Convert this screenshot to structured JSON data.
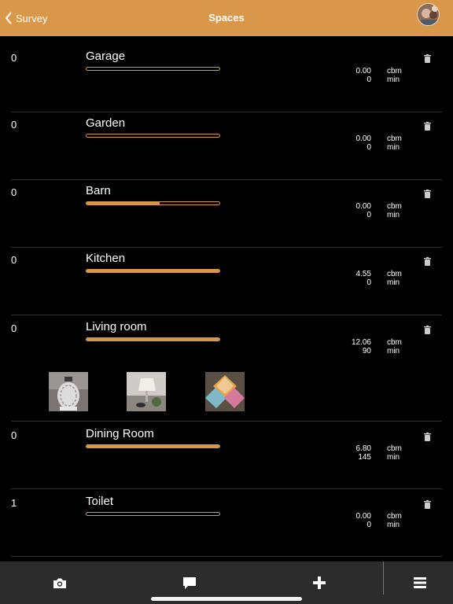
{
  "nav": {
    "back_label": "Survey",
    "title": "Spaces"
  },
  "spaces": [
    {
      "count": "0",
      "name": "Garage",
      "progress": 0,
      "volume": "0.00",
      "volume_unit": "cbm",
      "time": "0",
      "time_unit": "min"
    },
    {
      "count": "0",
      "name": "Garden",
      "progress": 0,
      "volume": "0.00",
      "volume_unit": "cbm",
      "time": "0",
      "time_unit": "min"
    },
    {
      "count": "0",
      "name": "Barn",
      "progress": 0.55,
      "volume": "0.00",
      "volume_unit": "cbm",
      "time": "0",
      "time_unit": "min"
    },
    {
      "count": "0",
      "name": "Kitchen",
      "progress": 1,
      "volume": "4.55",
      "volume_unit": "cbm",
      "time": "0",
      "time_unit": "min"
    },
    {
      "count": "0",
      "name": "Living room",
      "progress": 1,
      "volume": "12.06",
      "volume_unit": "cbm",
      "time": "90",
      "time_unit": "min"
    },
    {
      "count": "0",
      "name": "Dining Room",
      "progress": 1,
      "volume": "6.80",
      "volume_unit": "cbm",
      "time": "145",
      "time_unit": "min"
    },
    {
      "count": "1",
      "name": "Toilet",
      "progress": 0,
      "volume": "0.00",
      "volume_unit": "cbm",
      "time": "0",
      "time_unit": "min"
    }
  ],
  "photos": [
    "lantern-photo",
    "lamp-photo",
    "tiles-photo"
  ],
  "tabbar": [
    "camera-icon",
    "chat-icon",
    "plus-icon",
    "menu-icon"
  ],
  "colors": {
    "accent": "#d9974a",
    "background": "#000000",
    "tabbar": "#2c2c2c"
  }
}
